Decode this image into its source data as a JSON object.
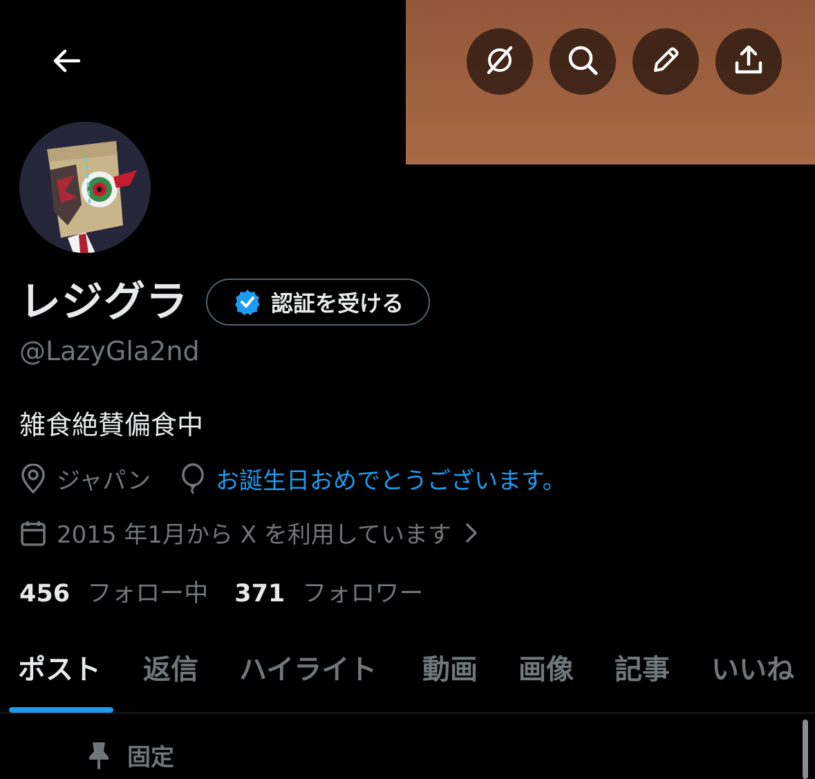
{
  "header": {
    "back_icon": "arrow-left-icon",
    "buttons": [
      {
        "icon": "grok-icon"
      },
      {
        "icon": "search-icon"
      },
      {
        "icon": "pencil-icon"
      },
      {
        "icon": "share-icon"
      }
    ]
  },
  "profile": {
    "display_name": "レジグラ",
    "verify_button_label": "認証を受ける",
    "handle": "@LazyGla2nd",
    "bio": "雑食絶賛偏食中",
    "location": "ジャパン",
    "birthday_message": "お誕生日おめでとうございます。",
    "joined": "2015 年1月から X を利用しています",
    "following_count": "456",
    "following_label": "フォロー中",
    "followers_count": "371",
    "followers_label": "フォロワー"
  },
  "tabs": [
    {
      "label": "ポスト",
      "active": true
    },
    {
      "label": "返信",
      "active": false
    },
    {
      "label": "ハイライト",
      "active": false
    },
    {
      "label": "動画",
      "active": false
    },
    {
      "label": "画像",
      "active": false
    },
    {
      "label": "記事",
      "active": false
    },
    {
      "label": "いいね",
      "active": false
    }
  ],
  "pinned": {
    "label": "固定"
  },
  "colors": {
    "background": "#000000",
    "banner": "#a0623f",
    "accent": "#1d9bf0",
    "muted_text": "#71767b",
    "primary_text": "#e7e9ea"
  }
}
